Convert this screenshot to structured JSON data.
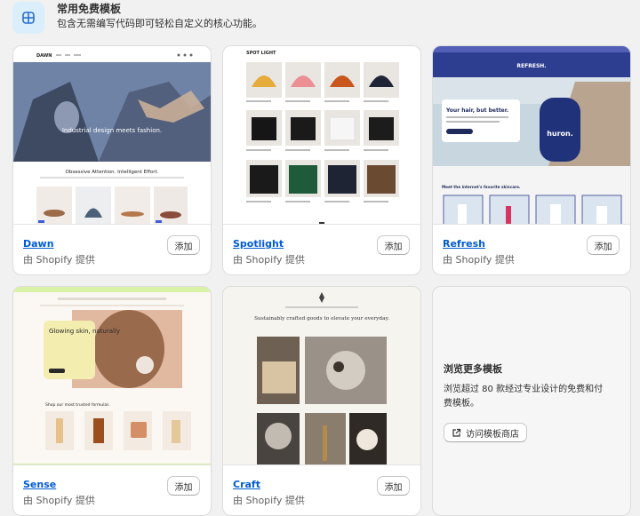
{
  "header": {
    "title": "常用免费模板",
    "subtitle": "包含无需编写代码即可轻松自定义的核心功能。"
  },
  "templates": [
    {
      "name": "Dawn",
      "by": "由 Shopify 提供",
      "add_label": "添加",
      "preview": {
        "logo": "DAWN",
        "hero_text": "Industrial design meets fashion.",
        "section_title": "Obsessive Attention. Intelligent Effort."
      }
    },
    {
      "name": "Spotlight",
      "by": "由 Shopify 提供",
      "add_label": "添加",
      "preview": {
        "logo": "SPOT LIGHT"
      }
    },
    {
      "name": "Refresh",
      "by": "由 Shopify 提供",
      "add_label": "添加",
      "preview": {
        "logo": "REFRESH.",
        "hero_title": "Your hair, but better.",
        "product_label": "huron.",
        "section_title": "Meet the internet's favorite skincare."
      }
    },
    {
      "name": "Sense",
      "by": "由 Shopify 提供",
      "add_label": "添加",
      "preview": {
        "hero_title": "Glowing skin, naturally",
        "section_title": "Shop our most trusted formulas"
      }
    },
    {
      "name": "Craft",
      "by": "由 Shopify 提供",
      "add_label": "添加",
      "preview": {
        "hero_title": "Sustainably crafted goods to elevate your everyday."
      }
    }
  ],
  "more": {
    "title": "浏览更多模板",
    "description": "浏览超过 80 款经过专业设计的免费和付费模板。",
    "button_label": "访问模板商店"
  },
  "colors": {
    "link": "#005bd3",
    "icon_bg": "#dbeefc",
    "refresh_nav": "#2d3d8f",
    "sense_banner": "#d9f2a5"
  }
}
